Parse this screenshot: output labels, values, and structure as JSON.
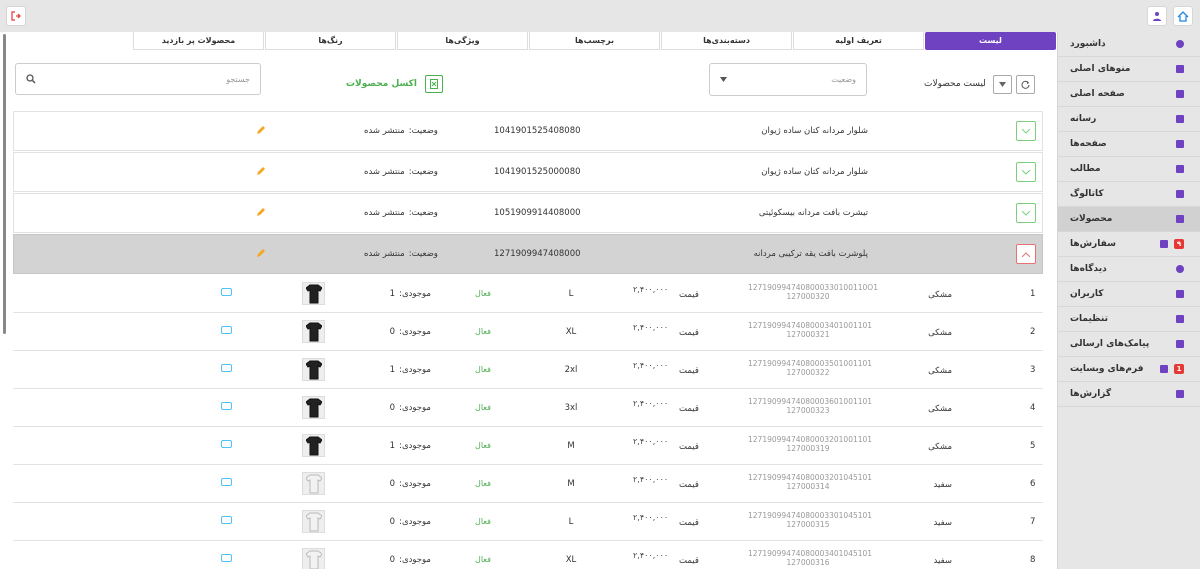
{
  "topbar": {
    "home_icon": "home-icon",
    "user_icon": "user-icon",
    "logout_icon": "logout-icon"
  },
  "sidebar": {
    "items": [
      {
        "label": "داشبورد",
        "icon": "dashboard-icon",
        "active": false
      },
      {
        "label": "منوهای اصلی",
        "icon": "list-icon",
        "active": false
      },
      {
        "label": "صفحه اصلی",
        "icon": "home-page-icon",
        "active": false
      },
      {
        "label": "رسانه",
        "icon": "media-icon",
        "active": false
      },
      {
        "label": "صفحه‌ها",
        "icon": "pages-icon",
        "active": false
      },
      {
        "label": "مطالب",
        "icon": "posts-icon",
        "active": false
      },
      {
        "label": "کاتالوگ",
        "icon": "catalog-icon",
        "active": false
      },
      {
        "label": "محصولات",
        "icon": "store-icon",
        "active": true
      },
      {
        "label": "سفارش‌ها",
        "icon": "cart-icon",
        "active": false,
        "badge": "۹"
      },
      {
        "label": "دیدگاه‌ها",
        "icon": "comment-icon",
        "active": false
      },
      {
        "label": "کاربران",
        "icon": "users-icon",
        "active": false
      },
      {
        "label": "تنظیمات",
        "icon": "settings-icon",
        "active": false
      },
      {
        "label": "پیامک‌های ارسالی",
        "icon": "history-icon",
        "active": false
      },
      {
        "label": "فرم‌های وبسایت",
        "icon": "form-icon",
        "active": false,
        "badge": "1"
      },
      {
        "label": "گزارش‌ها",
        "icon": "report-icon",
        "active": false
      }
    ]
  },
  "tabs": [
    {
      "label": "لیست",
      "active": true
    },
    {
      "label": "تعریف اولیه",
      "active": false
    },
    {
      "label": "دسته‌بندی‌ها",
      "active": false
    },
    {
      "label": "برچسب‌ها",
      "active": false
    },
    {
      "label": "ویژگی‌ها",
      "active": false
    },
    {
      "label": "رنگ‌ها",
      "active": false
    },
    {
      "label": "محصولات پر بازدید",
      "active": false
    }
  ],
  "toolbar": {
    "list_label": "لیست محصولات",
    "status_placeholder": "وضعیت",
    "excel_label": "اکسل محصولات",
    "search_placeholder": "جستجو"
  },
  "products": [
    {
      "name": "شلوار مردانه کتان ساده ژیوان",
      "code": "1041901525408080",
      "status_label": "وضعیت:",
      "status": "منتشر شده",
      "expanded": false
    },
    {
      "name": "شلوار مردانه کتان ساده ژیوان",
      "code": "1041901525000080",
      "status_label": "وضعیت:",
      "status": "منتشر شده",
      "expanded": false
    },
    {
      "name": "تیشرت بافت مردانه بیسکوئیتی",
      "code": "1051909914408000",
      "status_label": "وضعیت:",
      "status": "منتشر شده",
      "expanded": false
    },
    {
      "name": "پلوشرت بافت یقه ترکیبی مردانه",
      "code": "1271909947408000",
      "status_label": "وضعیت:",
      "status": "منتشر شده",
      "expanded": true
    }
  ],
  "variants": [
    {
      "num": "1",
      "color": "مشکی",
      "sku1": "1271909947408000330100110O1",
      "sku2": "127000320",
      "price_label": "قیمت",
      "price": "۲,۴۰۰,۰۰۰",
      "size": "L",
      "active": "فعال",
      "stock_label": "موجودی:",
      "stock": "1",
      "thumb": "black"
    },
    {
      "num": "2",
      "color": "مشکی",
      "sku1": "12719099474080003401001101",
      "sku2": "127000321",
      "price_label": "قیمت",
      "price": "۲,۴۰۰,۰۰۰",
      "size": "XL",
      "active": "فعال",
      "stock_label": "موجودی:",
      "stock": "0",
      "thumb": "black"
    },
    {
      "num": "3",
      "color": "مشکی",
      "sku1": "12719099474080003501001101",
      "sku2": "127000322",
      "price_label": "قیمت",
      "price": "۲,۴۰۰,۰۰۰",
      "size": "2xl",
      "active": "فعال",
      "stock_label": "موجودی:",
      "stock": "1",
      "thumb": "black"
    },
    {
      "num": "4",
      "color": "مشکی",
      "sku1": "12719099474080003601001101",
      "sku2": "127000323",
      "price_label": "قیمت",
      "price": "۲,۴۰۰,۰۰۰",
      "size": "3xl",
      "active": "فعال",
      "stock_label": "موجودی:",
      "stock": "0",
      "thumb": "black"
    },
    {
      "num": "5",
      "color": "مشکی",
      "sku1": "12719099474080003201001101",
      "sku2": "127000319",
      "price_label": "قیمت",
      "price": "۲,۴۰۰,۰۰۰",
      "size": "M",
      "active": "فعال",
      "stock_label": "موجودی:",
      "stock": "1",
      "thumb": "black"
    },
    {
      "num": "6",
      "color": "سفید",
      "sku1": "12719099474080003201045101",
      "sku2": "127000314",
      "price_label": "قیمت",
      "price": "۲,۴۰۰,۰۰۰",
      "size": "M",
      "active": "فعال",
      "stock_label": "موجودی:",
      "stock": "0",
      "thumb": "white"
    },
    {
      "num": "7",
      "color": "سفید",
      "sku1": "12719099474080003301045101",
      "sku2": "127000315",
      "price_label": "قیمت",
      "price": "۲,۴۰۰,۰۰۰",
      "size": "L",
      "active": "فعال",
      "stock_label": "موجودی:",
      "stock": "0",
      "thumb": "white"
    },
    {
      "num": "8",
      "color": "سفید",
      "sku1": "12719099474080003401045101",
      "sku2": "127000316",
      "price_label": "قیمت",
      "price": "۲,۴۰۰,۰۰۰",
      "size": "XL",
      "active": "فعال",
      "stock_label": "موجودی:",
      "stock": "0",
      "thumb": "white"
    }
  ],
  "colors": {
    "accent": "#6f42c1",
    "success": "#4caf50",
    "danger": "#e53935"
  }
}
